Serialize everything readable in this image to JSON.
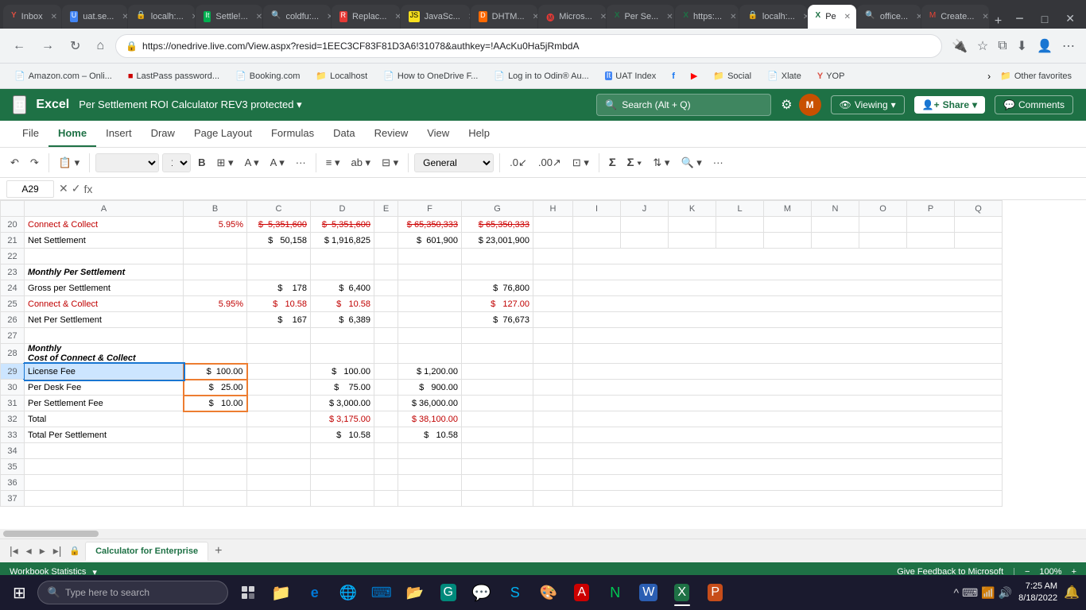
{
  "browser": {
    "tabs": [
      {
        "id": "tab1",
        "favicon": "Y",
        "title": "Inbox",
        "active": false
      },
      {
        "id": "tab2",
        "favicon": "U",
        "title": "uat.se...",
        "active": false
      },
      {
        "id": "tab3",
        "favicon": "L",
        "title": "localh:...",
        "active": false
      },
      {
        "id": "tab4",
        "favicon": "It",
        "title": "Settle!...",
        "active": false
      },
      {
        "id": "tab5",
        "favicon": "🔍",
        "title": "coldfu:...",
        "active": false
      },
      {
        "id": "tab6",
        "favicon": "R",
        "title": "Replac...",
        "active": false
      },
      {
        "id": "tab7",
        "favicon": "JS",
        "title": "JavaSc...",
        "active": false
      },
      {
        "id": "tab8",
        "favicon": "D",
        "title": "DHTM...",
        "active": false
      },
      {
        "id": "tab9",
        "favicon": "O",
        "title": "Micros...",
        "active": false
      },
      {
        "id": "tab10",
        "favicon": "X",
        "title": "Per Se...",
        "active": false
      },
      {
        "id": "tab11",
        "favicon": "X",
        "title": "https:...",
        "active": false
      },
      {
        "id": "tab12",
        "favicon": "L",
        "title": "localh:...",
        "active": false
      },
      {
        "id": "tab13",
        "favicon": "X",
        "title": "Pe",
        "active": true
      },
      {
        "id": "tab14",
        "favicon": "🔍",
        "title": "office...",
        "active": false
      },
      {
        "id": "tab15",
        "favicon": "M",
        "title": "Create...",
        "active": false
      }
    ],
    "address": "https://onedrive.live.com/View.aspx?resid=1EEC3CF83F81D3A6!31078&authkey=!AAcKu0Ha5jRmbdA",
    "bookmarks": [
      {
        "title": "Amazon.com – Onli...",
        "icon": "bookmark"
      },
      {
        "title": "LastPass password...",
        "icon": "bookmark"
      },
      {
        "title": "Booking.com",
        "icon": "bookmark"
      },
      {
        "title": "Localhost",
        "icon": "folder"
      },
      {
        "title": "How to OneDrive F...",
        "icon": "bookmark"
      },
      {
        "title": "Log in to Odin® Au...",
        "icon": "bookmark"
      },
      {
        "title": "UAT Index",
        "icon": "bookmark"
      },
      {
        "title": "facebook",
        "icon": "f"
      },
      {
        "title": "youtube",
        "icon": "▶"
      },
      {
        "title": "Social",
        "icon": "folder"
      },
      {
        "title": "Xlate",
        "icon": "bookmark"
      },
      {
        "title": "YOP",
        "icon": "Y"
      },
      {
        "title": "Other favorites",
        "icon": "folder"
      }
    ]
  },
  "excel": {
    "app_name": "Excel",
    "title": "Per Settlement ROI Calculator REV3 protected",
    "search_placeholder": "Search (Alt + Q)",
    "viewing_label": "Viewing",
    "share_label": "Share",
    "comments_label": "Comments",
    "ribbon_tabs": [
      "File",
      "Home",
      "Insert",
      "Draw",
      "Page Layout",
      "Formulas",
      "Data",
      "Review",
      "View",
      "Help"
    ],
    "active_tab": "Home",
    "cell_ref": "A29",
    "formula_text": "fx",
    "sheet_tabs": [
      "Calculator for Enterprise"
    ],
    "status_text": "Workbook Statistics",
    "status_right": "Give Feedback to Microsoft",
    "zoom": "100%",
    "columns": [
      "A",
      "B",
      "C",
      "D",
      "E",
      "F",
      "G",
      "H",
      "I",
      "J",
      "K",
      "L",
      "M",
      "N",
      "O",
      "P",
      "Q"
    ],
    "rows": [
      {
        "row_num": "20",
        "cells": [
          {
            "col": "A",
            "value": "Connect & Collect",
            "style": "red"
          },
          {
            "col": "B",
            "value": "5.95%",
            "style": "red"
          },
          {
            "col": "C",
            "value": "$ 5,351,600",
            "style": "red strikethrough"
          },
          {
            "col": "D",
            "value": "$ 5,351,600",
            "style": "red strikethrough"
          },
          {
            "col": "E",
            "value": ""
          },
          {
            "col": "F",
            "value": "$ 65,350,333",
            "style": "red strikethrough"
          },
          {
            "col": "G",
            "value": "$ 65,350,333",
            "style": "red strikethrough"
          }
        ]
      },
      {
        "row_num": "21",
        "cells": [
          {
            "col": "A",
            "value": "Net Settlement",
            "style": ""
          },
          {
            "col": "B",
            "value": "",
            "style": ""
          },
          {
            "col": "C",
            "value": "$ 50,158",
            "style": ""
          },
          {
            "col": "D",
            "value": "$ 1,916,825",
            "style": ""
          },
          {
            "col": "E",
            "value": ""
          },
          {
            "col": "F",
            "value": "$ 601,900",
            "style": ""
          },
          {
            "col": "G",
            "value": "$ 23,001,900",
            "style": ""
          }
        ]
      },
      {
        "row_num": "22",
        "cells": []
      },
      {
        "row_num": "23",
        "cells": [
          {
            "col": "A",
            "value": "Monthly Per Settlement",
            "style": "bold italic"
          }
        ]
      },
      {
        "row_num": "24",
        "cells": [
          {
            "col": "A",
            "value": "Gross per Settlement",
            "style": ""
          },
          {
            "col": "B",
            "value": "",
            "style": ""
          },
          {
            "col": "C",
            "value": "$ 178",
            "style": ""
          },
          {
            "col": "D",
            "value": "$ 6,400",
            "style": ""
          },
          {
            "col": "E",
            "value": ""
          },
          {
            "col": "F",
            "value": "",
            "style": ""
          },
          {
            "col": "G",
            "value": "$ 76,800",
            "style": ""
          }
        ]
      },
      {
        "row_num": "25",
        "cells": [
          {
            "col": "A",
            "value": "Connect & Collect",
            "style": "red"
          },
          {
            "col": "B",
            "value": "5.95%",
            "style": "red"
          },
          {
            "col": "C",
            "value": "$ 10.58",
            "style": "red"
          },
          {
            "col": "D",
            "value": "$ 10.58",
            "style": "red"
          },
          {
            "col": "E",
            "value": ""
          },
          {
            "col": "F",
            "value": "",
            "style": ""
          },
          {
            "col": "G",
            "value": "$ 127.00",
            "style": "red"
          }
        ]
      },
      {
        "row_num": "26",
        "cells": [
          {
            "col": "A",
            "value": "Net Per Settlement",
            "style": ""
          },
          {
            "col": "B",
            "value": "",
            "style": ""
          },
          {
            "col": "C",
            "value": "$ 167",
            "style": ""
          },
          {
            "col": "D",
            "value": "$ 6,389",
            "style": ""
          },
          {
            "col": "E",
            "value": ""
          },
          {
            "col": "F",
            "value": "",
            "style": ""
          },
          {
            "col": "G",
            "value": "$ 76,673",
            "style": ""
          }
        ]
      },
      {
        "row_num": "27",
        "cells": []
      },
      {
        "row_num": "28",
        "cells": [
          {
            "col": "A",
            "value": "Monthly",
            "style": "bold italic"
          },
          {
            "col": "B",
            "value": "",
            "style": ""
          },
          {
            "col": "C",
            "value": "",
            "style": ""
          },
          {
            "col": "D",
            "value": "",
            "style": ""
          },
          {
            "col": "E",
            "value": ""
          },
          {
            "col": "F",
            "value": "",
            "style": ""
          },
          {
            "col": "G",
            "value": "",
            "style": ""
          }
        ]
      },
      {
        "row_num": "28b",
        "cells": [
          {
            "col": "A",
            "value": "Cost of Connect & Collect",
            "style": "bold italic"
          }
        ]
      },
      {
        "row_num": "29",
        "cells": [
          {
            "col": "A",
            "value": "License Fee",
            "style": "selected orange-border"
          },
          {
            "col": "B",
            "value": "$ 100.00",
            "style": "orange-border align-right"
          },
          {
            "col": "C",
            "value": "",
            "style": ""
          },
          {
            "col": "D",
            "value": "$ 100.00",
            "style": "align-right"
          },
          {
            "col": "E",
            "value": ""
          },
          {
            "col": "F",
            "value": "$ 1,200.00",
            "style": "align-right"
          },
          {
            "col": "G",
            "value": "",
            "style": ""
          }
        ]
      },
      {
        "row_num": "30",
        "cells": [
          {
            "col": "A",
            "value": "Per Desk Fee",
            "style": ""
          },
          {
            "col": "B",
            "value": "$ 25.00",
            "style": "orange-border align-right"
          },
          {
            "col": "C",
            "value": "",
            "style": ""
          },
          {
            "col": "D",
            "value": "$ 75.00",
            "style": "align-right"
          },
          {
            "col": "E",
            "value": ""
          },
          {
            "col": "F",
            "value": "$ 900.00",
            "style": "align-right"
          },
          {
            "col": "G",
            "value": "",
            "style": ""
          }
        ]
      },
      {
        "row_num": "31",
        "cells": [
          {
            "col": "A",
            "value": "Per Settlement Fee",
            "style": ""
          },
          {
            "col": "B",
            "value": "$ 10.00",
            "style": "orange-border align-right"
          },
          {
            "col": "C",
            "value": "",
            "style": ""
          },
          {
            "col": "D",
            "value": "$ 3,000.00",
            "style": "align-right"
          },
          {
            "col": "E",
            "value": ""
          },
          {
            "col": "F",
            "value": "$ 36,000.00",
            "style": "align-right"
          },
          {
            "col": "G",
            "value": "",
            "style": ""
          }
        ]
      },
      {
        "row_num": "32",
        "cells": [
          {
            "col": "A",
            "value": "Total",
            "style": ""
          },
          {
            "col": "B",
            "value": "",
            "style": ""
          },
          {
            "col": "C",
            "value": "",
            "style": ""
          },
          {
            "col": "D",
            "value": "$ 3,175.00",
            "style": "red align-right"
          },
          {
            "col": "E",
            "value": ""
          },
          {
            "col": "F",
            "value": "$ 38,100.00",
            "style": "red align-right"
          },
          {
            "col": "G",
            "value": "",
            "style": ""
          }
        ]
      },
      {
        "row_num": "33",
        "cells": [
          {
            "col": "A",
            "value": "Total Per Settlement",
            "style": ""
          },
          {
            "col": "B",
            "value": "",
            "style": ""
          },
          {
            "col": "C",
            "value": "",
            "style": ""
          },
          {
            "col": "D",
            "value": "$ 10.58",
            "style": "align-right"
          },
          {
            "col": "E",
            "value": ""
          },
          {
            "col": "F",
            "value": "$ 10.58",
            "style": "align-right"
          },
          {
            "col": "G",
            "value": "",
            "style": ""
          }
        ]
      },
      {
        "row_num": "34",
        "cells": []
      },
      {
        "row_num": "35",
        "cells": []
      },
      {
        "row_num": "36",
        "cells": []
      },
      {
        "row_num": "37",
        "cells": []
      }
    ]
  },
  "taskbar": {
    "search_placeholder": "Type here to search",
    "apps": [
      {
        "name": "Windows",
        "icon": "⊞"
      },
      {
        "name": "Task View",
        "icon": "❑"
      },
      {
        "name": "File Explorer",
        "icon": "📁"
      },
      {
        "name": "Edge",
        "icon": "e"
      },
      {
        "name": "Edge2",
        "icon": "🌐"
      },
      {
        "name": "VSCode",
        "icon": "⌨"
      },
      {
        "name": "Explorer2",
        "icon": "📂"
      },
      {
        "name": "Google Meet",
        "icon": "G"
      },
      {
        "name": "Whatsapp",
        "icon": "W"
      },
      {
        "name": "Skype",
        "icon": "S"
      },
      {
        "name": "Paint",
        "icon": "🎨"
      },
      {
        "name": "Unknown",
        "icon": "A"
      },
      {
        "name": "Unknown2",
        "icon": "N"
      },
      {
        "name": "Word",
        "icon": "W"
      },
      {
        "name": "Excel",
        "icon": "X"
      },
      {
        "name": "PowerPoint",
        "icon": "P"
      }
    ],
    "sys_icons": [
      "🔧",
      "🔊",
      "📶",
      "🔋"
    ],
    "time": "7:25 AM",
    "date": "8/18/2022"
  }
}
